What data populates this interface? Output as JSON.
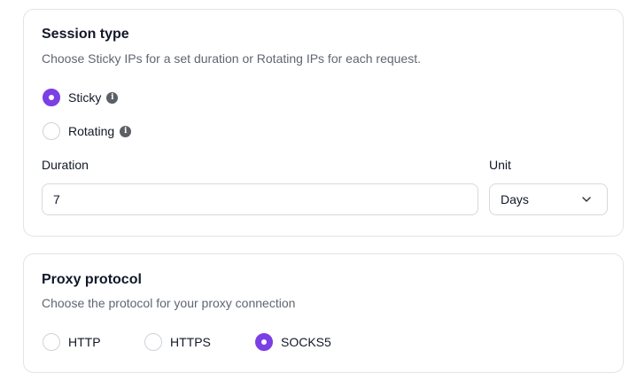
{
  "session": {
    "title": "Session type",
    "subtitle": "Choose Sticky IPs for a set duration or Rotating IPs for each request.",
    "options": [
      {
        "label": "Sticky",
        "selected": true
      },
      {
        "label": "Rotating",
        "selected": false
      }
    ],
    "duration_label": "Duration",
    "duration_value": "7",
    "unit_label": "Unit",
    "unit_value": "Days"
  },
  "proxy": {
    "title": "Proxy protocol",
    "subtitle": "Choose the protocol for your proxy connection",
    "options": [
      {
        "label": "HTTP",
        "selected": false
      },
      {
        "label": "HTTPS",
        "selected": false
      },
      {
        "label": "SOCKS5",
        "selected": true
      }
    ]
  },
  "icons": {
    "info": "info-icon",
    "chevron": "chevron-down-icon"
  },
  "colors": {
    "accent": "#7b3fe4",
    "border": "#e3e4e8",
    "muted_text": "#5f6673"
  }
}
